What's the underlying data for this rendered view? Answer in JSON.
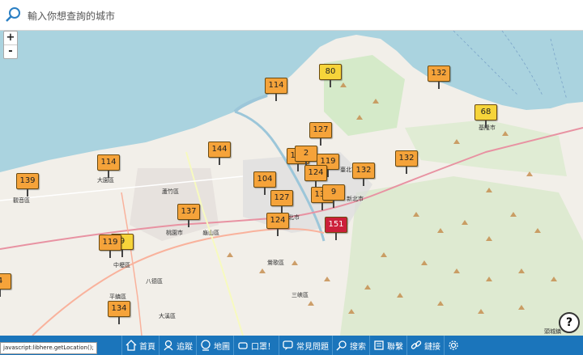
{
  "search": {
    "placeholder": "輸入你想查詢的城市"
  },
  "zoom": {
    "in_label": "+",
    "out_label": "-"
  },
  "markers": [
    {
      "value": "114",
      "level": "orange"
    },
    {
      "value": "80",
      "level": "yellow"
    },
    {
      "value": "132",
      "level": "orange"
    },
    {
      "value": "68",
      "level": "yellow"
    },
    {
      "value": "127",
      "level": "orange"
    },
    {
      "value": "144",
      "level": "orange"
    },
    {
      "value": "114",
      "level": "orange"
    },
    {
      "value": "124",
      "level": "orange"
    },
    {
      "value": "2",
      "level": "orange"
    },
    {
      "value": "119",
      "level": "orange"
    },
    {
      "value": "132",
      "level": "orange"
    },
    {
      "value": "132",
      "level": "orange"
    },
    {
      "value": "139",
      "level": "orange"
    },
    {
      "value": "104",
      "level": "orange"
    },
    {
      "value": "124",
      "level": "orange"
    },
    {
      "value": "127",
      "level": "orange"
    },
    {
      "value": "134",
      "level": "orange"
    },
    {
      "value": "9",
      "level": "orange"
    },
    {
      "value": "137",
      "level": "orange"
    },
    {
      "value": "124",
      "level": "orange"
    },
    {
      "value": "151",
      "level": "red"
    },
    {
      "value": "119",
      "level": "orange"
    },
    {
      "value": "9",
      "level": "yellow"
    },
    {
      "value": "4",
      "level": "orange"
    },
    {
      "value": "134",
      "level": "orange"
    }
  ],
  "map_labels": [
    "基隆市",
    "桃園市",
    "新北市",
    "北市",
    "臺北市",
    "蘆竹區",
    "大溪區",
    "中壢區",
    "龜山區",
    "八德區",
    "觀音區",
    "平鎮區",
    "大園區",
    "鶯歌區",
    "三峽區",
    "頭城鎮"
  ],
  "status_text": "javascript:libhere.getLocation();",
  "nav": [
    {
      "label": "首頁",
      "icon": "home-icon"
    },
    {
      "label": "追蹤",
      "icon": "user-pin-icon"
    },
    {
      "label": "地圖",
      "icon": "globe-icon"
    },
    {
      "label": "口罩！",
      "icon": "mask-icon"
    },
    {
      "label": "常見問題",
      "icon": "chat-icon"
    },
    {
      "label": "搜索",
      "icon": "search-icon"
    },
    {
      "label": "聯繫",
      "icon": "contact-icon"
    },
    {
      "label": "鏈接",
      "icon": "link-icon"
    },
    {
      "label": "",
      "icon": "gear-icon"
    }
  ],
  "colors": {
    "navbar": "#1b75bb",
    "aqi_moderate": "#f6d43a",
    "aqi_sensitive": "#f5a33a",
    "aqi_unhealthy": "#cc1f3a"
  }
}
